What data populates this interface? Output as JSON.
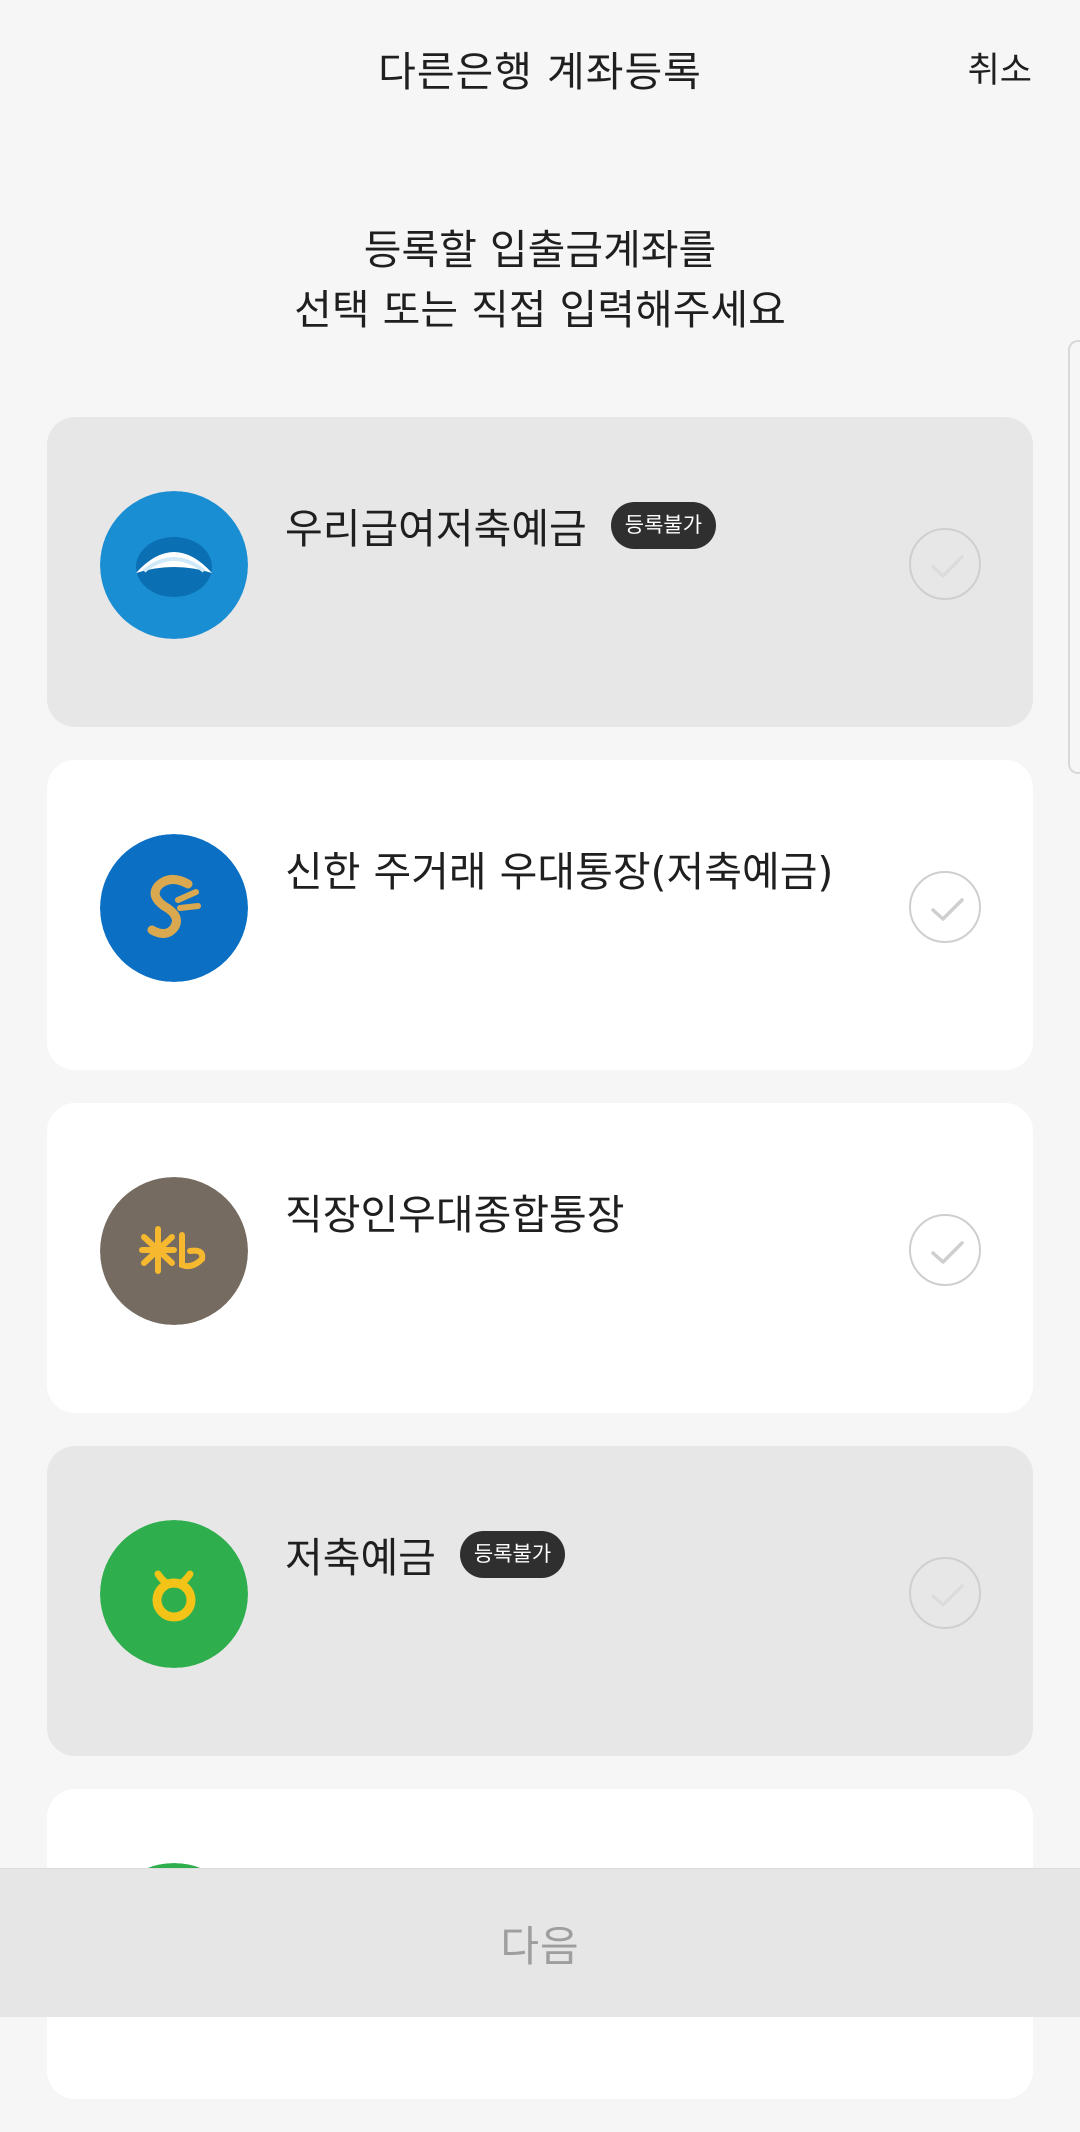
{
  "header": {
    "title": "다른은행 계좌등록",
    "cancel_label": "취소"
  },
  "subtitle": {
    "line1": "등록할 입출금계좌를",
    "line2": "선택 또는 직접 입력해주세요"
  },
  "accounts": [
    {
      "name": "우리급여저축예금",
      "badge": "등록불가",
      "disabled": true,
      "icon": "woori-bank-logo-icon",
      "color": "#1a8ed3"
    },
    {
      "name": "신한 주거래 우대통장(저축예금)",
      "badge": "",
      "disabled": false,
      "icon": "shinhan-bank-logo-icon",
      "color": "#0b6fc4"
    },
    {
      "name": "직장인우대종합통장",
      "badge": "",
      "disabled": false,
      "icon": "kb-bank-logo-icon",
      "color": "#766b60"
    },
    {
      "name": "저축예금",
      "badge": "등록불가",
      "disabled": true,
      "icon": "nh-bank-logo-icon",
      "color": "#2fae4d"
    }
  ],
  "bottom": {
    "next_label": "다음"
  },
  "colors": {
    "background": "#f6f6f6",
    "card_enabled": "#ffffff",
    "card_disabled": "#e7e7e7",
    "badge_bg": "#2f2f2f",
    "next_bar": "#e6e6e6"
  }
}
